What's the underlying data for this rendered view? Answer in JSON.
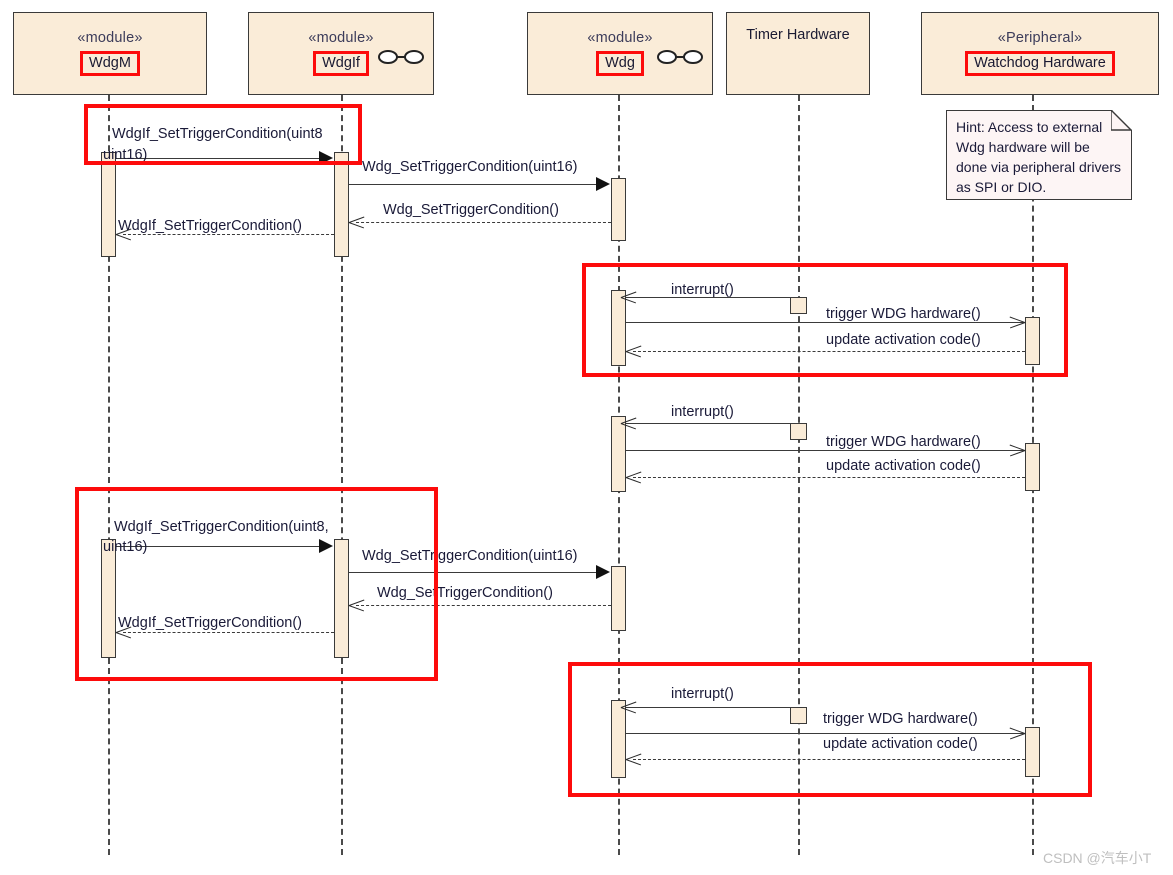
{
  "diagram": {
    "kind": "uml-sequence-diagram",
    "watermark": "CSDN @汽车小T",
    "colors": {
      "highlight": "#fd0b0b",
      "lifeline_fill": "#faecd8",
      "note_fill": "#fdf5f5",
      "text": "#1a1a38"
    }
  },
  "lifelines": [
    {
      "id": "wdgm",
      "stereotype": "«module»",
      "name": "WdgM",
      "name_highlighted": true,
      "has_socket_icon": false
    },
    {
      "id": "wdgif",
      "stereotype": "«module»",
      "name": "WdgIf",
      "name_highlighted": true,
      "has_socket_icon": true
    },
    {
      "id": "wdg",
      "stereotype": "«module»",
      "name": "Wdg",
      "name_highlighted": true,
      "has_socket_icon": true
    },
    {
      "id": "timer",
      "stereotype": "",
      "name": "Timer Hardware",
      "name_highlighted": false,
      "has_socket_icon": false
    },
    {
      "id": "wdghw",
      "stereotype": "«Peripheral»",
      "name": "Watchdog Hardware",
      "name_highlighted": true,
      "has_socket_icon": false
    }
  ],
  "note": {
    "id": "hint-note",
    "text": "Hint: Access to external Wdg hardware will be done via peripheral drivers as SPI or DIO."
  },
  "messages": [
    {
      "id": "m1",
      "label": "WdgIf_SetTriggerCondition(uint8, uint16)",
      "from": "wdgm",
      "to": "wdgif",
      "type": "call",
      "group": "set-trigger-1"
    },
    {
      "id": "m2",
      "label": "Wdg_SetTriggerCondition(uint16)",
      "from": "wdgif",
      "to": "wdg",
      "type": "call",
      "group": "set-trigger-1"
    },
    {
      "id": "m3",
      "label": "Wdg_SetTriggerCondition()",
      "from": "wdg",
      "to": "wdgif",
      "type": "return",
      "group": "set-trigger-1"
    },
    {
      "id": "m4",
      "label": "WdgIf_SetTriggerCondition()",
      "from": "wdgif",
      "to": "wdgm",
      "type": "return",
      "group": "set-trigger-1"
    },
    {
      "id": "m5",
      "label": "interrupt()",
      "from": "timer",
      "to": "wdg",
      "type": "call",
      "group": "interrupt-1"
    },
    {
      "id": "m6",
      "label": "trigger WDG hardware()",
      "from": "wdg",
      "to": "wdghw",
      "type": "call",
      "group": "interrupt-1"
    },
    {
      "id": "m7",
      "label": "update activation code()",
      "from": "wdghw",
      "to": "wdg",
      "type": "return",
      "group": "interrupt-1"
    },
    {
      "id": "m8",
      "label": "interrupt()",
      "from": "timer",
      "to": "wdg",
      "type": "call",
      "group": "interrupt-2"
    },
    {
      "id": "m9",
      "label": "trigger WDG hardware()",
      "from": "wdg",
      "to": "wdghw",
      "type": "call",
      "group": "interrupt-2"
    },
    {
      "id": "m10",
      "label": "update activation code()",
      "from": "wdghw",
      "to": "wdg",
      "type": "return",
      "group": "interrupt-2"
    },
    {
      "id": "m11",
      "label": "WdgIf_SetTriggerCondition(uint8, uint16)",
      "from": "wdgm",
      "to": "wdgif",
      "type": "call",
      "group": "set-trigger-2"
    },
    {
      "id": "m12",
      "label": "Wdg_SetTriggerCondition(uint16)",
      "from": "wdgif",
      "to": "wdg",
      "type": "call",
      "group": "set-trigger-2"
    },
    {
      "id": "m13",
      "label": "Wdg_SetTriggerCondition()",
      "from": "wdg",
      "to": "wdgif",
      "type": "return",
      "group": "set-trigger-2"
    },
    {
      "id": "m14",
      "label": "WdgIf_SetTriggerCondition()",
      "from": "wdgif",
      "to": "wdgm",
      "type": "return",
      "group": "set-trigger-2"
    },
    {
      "id": "m15",
      "label": "interrupt()",
      "from": "timer",
      "to": "wdg",
      "type": "call",
      "group": "interrupt-3"
    },
    {
      "id": "m16",
      "label": "trigger WDG hardware()",
      "from": "wdg",
      "to": "wdghw",
      "type": "call",
      "group": "interrupt-3"
    },
    {
      "id": "m17",
      "label": "update activation code()",
      "from": "wdghw",
      "to": "wdg",
      "type": "return",
      "group": "interrupt-3"
    }
  ],
  "labels": {
    "m1_line1": "WdgIf_SetTriggerCondition(uint8",
    "m1_line2": "uint16)",
    "m11_line1": "WdgIf_SetTriggerCondition(uint8,",
    "m11_line2": "uint16)",
    "call_set_wdg": "Wdg_SetTriggerCondition(uint16)",
    "ret_set_wdg": "Wdg_SetTriggerCondition()",
    "ret_set_wdgif": "WdgIf_SetTriggerCondition()",
    "interrupt": "interrupt()",
    "trigger_hw": "trigger WDG hardware()",
    "update_code": "update activation code()"
  },
  "highlights": [
    {
      "id": "hl-set-trigger-1",
      "covers": "WdgIf_SetTriggerCondition call from WdgM to WdgIf"
    },
    {
      "id": "hl-interrupt-1",
      "covers": "first interrupt / trigger WDG hardware exchange"
    },
    {
      "id": "hl-set-trigger-2",
      "covers": "second WdgIf_SetTriggerCondition exchange"
    },
    {
      "id": "hl-interrupt-3",
      "covers": "third interrupt / trigger WDG hardware exchange"
    }
  ]
}
